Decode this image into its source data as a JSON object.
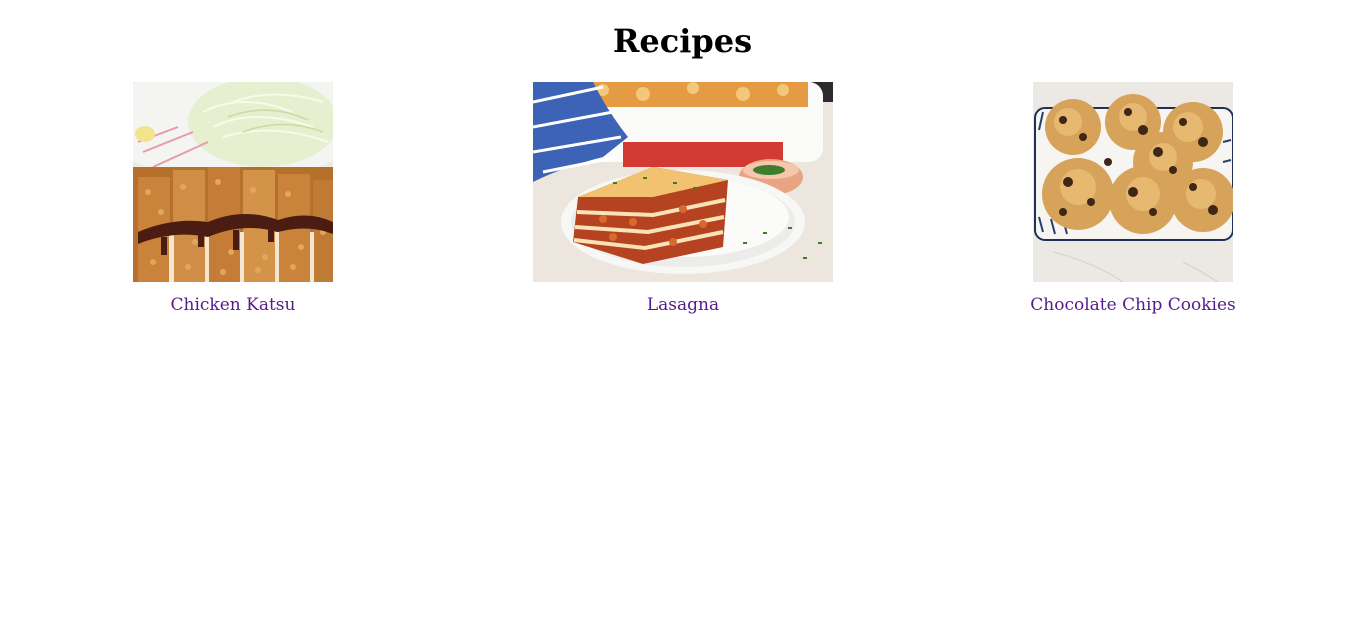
{
  "page": {
    "title": "Recipes"
  },
  "recipes": [
    {
      "name": "Chicken Katsu",
      "image": "chicken-katsu-photo",
      "link_color": "#551a8b"
    },
    {
      "name": "Lasagna",
      "image": "lasagna-photo",
      "link_color": "#551a8b"
    },
    {
      "name": "Chocolate Chip Cookies",
      "image": "chocolate-chip-cookies-photo",
      "link_color": "#551a8b"
    }
  ]
}
